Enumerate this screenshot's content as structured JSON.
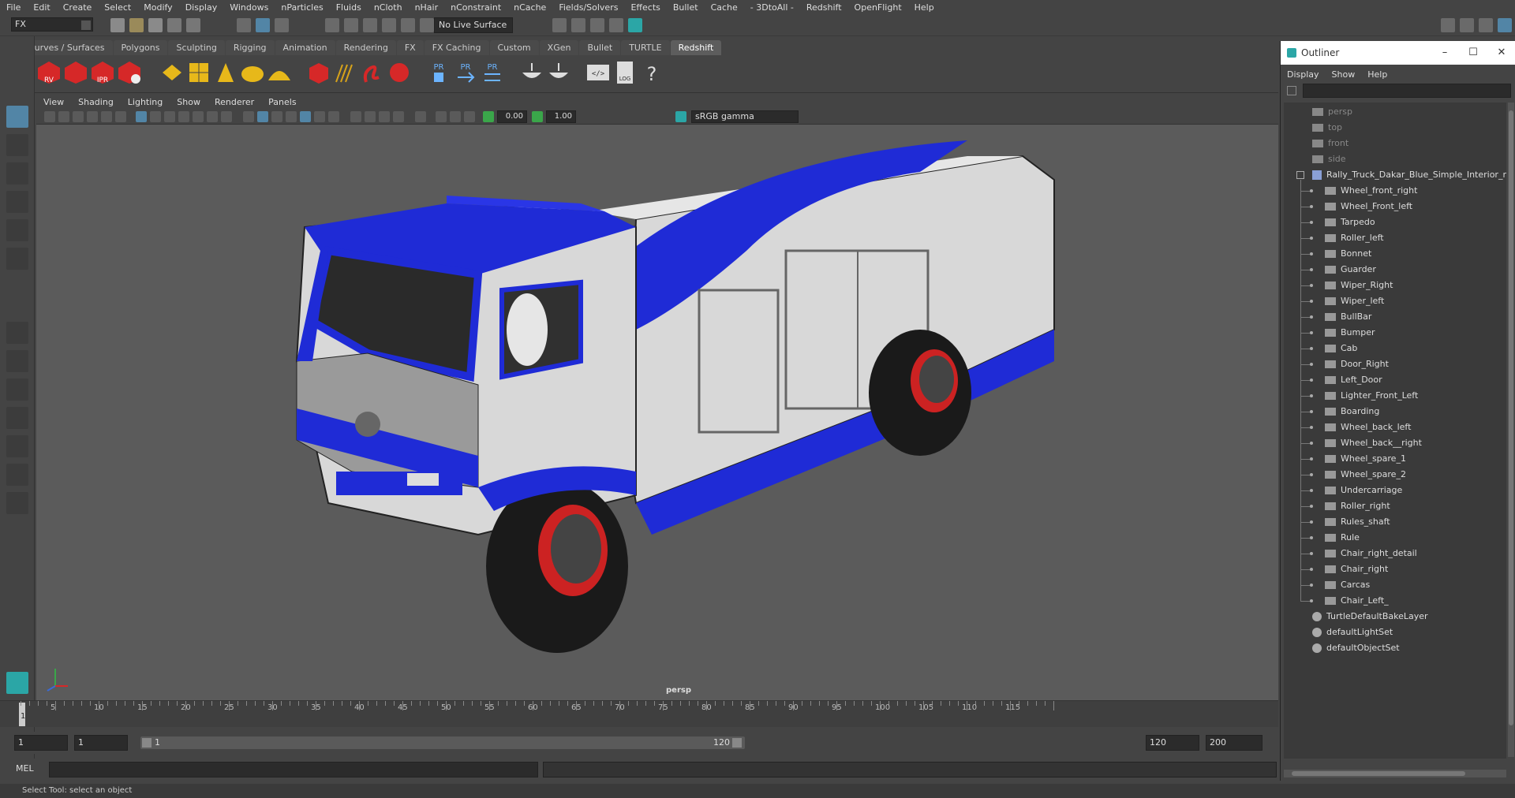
{
  "menubar": {
    "items": [
      "File",
      "Edit",
      "Create",
      "Select",
      "Modify",
      "Display",
      "Windows",
      "nParticles",
      "Fluids",
      "nCloth",
      "nHair",
      "nConstraint",
      "nCache",
      "Fields/Solvers",
      "Effects",
      "Bullet",
      "Cache",
      "- 3DtoAll -",
      "Redshift",
      "OpenFlight",
      "Help"
    ]
  },
  "statusline": {
    "mode": "FX",
    "live_surface": "No Live Surface"
  },
  "shelf": {
    "tabs": [
      "Curves / Surfaces",
      "Polygons",
      "Sculpting",
      "Rigging",
      "Animation",
      "Rendering",
      "FX",
      "FX Caching",
      "Custom",
      "XGen",
      "Bullet",
      "TURTLE",
      "Redshift"
    ],
    "active_tab": "Redshift",
    "icons": [
      "rv-icon",
      "render-icon",
      "ipr-icon",
      "render-settings-icon",
      "light-box-icon",
      "light-rect-icon",
      "light-spot-icon",
      "light-dome-icon",
      "light-sun-icon",
      "proxy-icon",
      "hair-icon",
      "volume-icon",
      "sphere-icon",
      "pr-object-icon",
      "pr-export-icon",
      "pr-swap-icon",
      "bowl-icon",
      "bowl2-icon",
      "script-icon",
      "log-icon",
      "help-icon"
    ],
    "icon_labels": {
      "rv": "RV",
      "ipr": "IPR",
      "pr": "PR",
      "log": "LOG",
      "help": "?"
    }
  },
  "panel": {
    "menu": [
      "View",
      "Shading",
      "Lighting",
      "Show",
      "Renderer",
      "Panels"
    ],
    "exposure": "0.00",
    "gamma": "1.00",
    "color_space": "sRGB gamma",
    "camera_label": "persp"
  },
  "timeslider": {
    "ticks": [
      "5",
      "10",
      "15",
      "20",
      "25",
      "30",
      "35",
      "40",
      "45",
      "50",
      "55",
      "60",
      "65",
      "70",
      "75",
      "80",
      "85",
      "90",
      "95",
      "100",
      "105",
      "110",
      "115"
    ],
    "current_frame": "1"
  },
  "range": {
    "start": "1",
    "start_inner": "1",
    "range_start_label": "1",
    "range_end_label": "120",
    "end_inner": "120",
    "end": "200"
  },
  "cmdline": {
    "mode": "MEL"
  },
  "helpline": {
    "text": "Select Tool: select an object"
  },
  "outliner": {
    "title": "Outliner",
    "menu": [
      "Display",
      "Show",
      "Help"
    ],
    "cameras": [
      "persp",
      "top",
      "front",
      "side"
    ],
    "root": "Rally_Truck_Dakar_Blue_Simple_Interior_r",
    "children": [
      "Wheel_front_right",
      "Wheel_Front_left",
      "Tarpedo",
      "Roller_left",
      "Bonnet",
      "Guarder",
      "Wiper_Right",
      "Wiper_left",
      "BullBar",
      "Bumper",
      "Cab",
      "Door_Right",
      "Left_Door",
      "Lighter_Front_Left",
      "Boarding",
      "Wheel_back_left",
      "Wheel_back__right",
      "Wheel_spare_1",
      "Wheel_spare_2",
      "Undercarriage",
      "Roller_right",
      "Rules_shaft",
      "Rule",
      "Chair_right_detail",
      "Chair_right",
      "Carcas",
      "Chair_Left_"
    ],
    "sets": [
      "TurtleDefaultBakeLayer",
      "defaultLightSet",
      "defaultObjectSet"
    ]
  },
  "colors": {
    "accent": "#5285a6",
    "truck_blue": "#1f2bd6",
    "truck_white": "#d8d8d8",
    "viewport_bg": "#5b5b5b",
    "redshift_red": "#d62828"
  }
}
